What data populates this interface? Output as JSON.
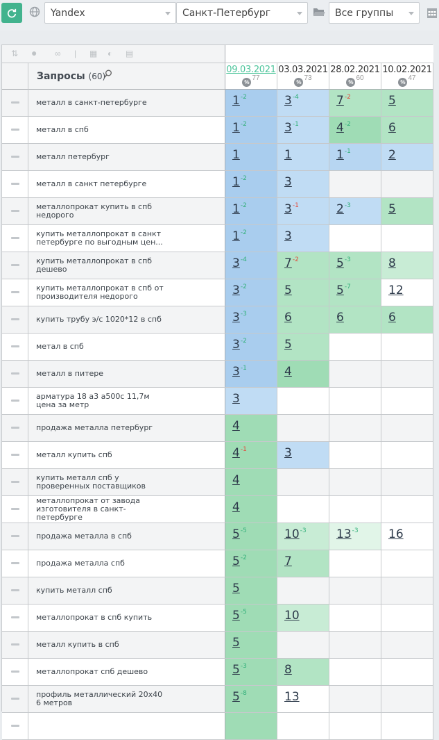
{
  "toolbar": {
    "engine": "Yandex",
    "region": "Санкт-Петербург",
    "group": "Все группы"
  },
  "header": {
    "title": "Запросы",
    "count": "(60)"
  },
  "dates": [
    {
      "date": "09.03.2021",
      "pct": "77",
      "active": true
    },
    {
      "date": "03.03.2021",
      "pct": "73",
      "active": false
    },
    {
      "date": "28.02.2021",
      "pct": "60",
      "active": false
    },
    {
      "date": "10.02.2021",
      "pct": "47",
      "active": false
    }
  ],
  "colors": {
    "accent": "#42b38e",
    "blue_cell": "#a9cdee",
    "green_cell": "#9fdcb5",
    "change_up": "#33b07a",
    "change_down": "#e24a3b"
  },
  "rows": [
    {
      "query": "металл в санкт-петербурге",
      "cells": [
        {
          "pos": "1",
          "ch": "-2",
          "dir": "g",
          "bg": "bl-d"
        },
        {
          "pos": "3",
          "ch": "-4",
          "dir": "g",
          "bg": "bl-l"
        },
        {
          "pos": "7",
          "ch": "-2",
          "dir": "r",
          "bg": "gr-m"
        },
        {
          "pos": "5",
          "ch": "",
          "dir": "",
          "bg": "gr-m"
        }
      ]
    },
    {
      "query": "металл в спб",
      "cells": [
        {
          "pos": "1",
          "ch": "-2",
          "dir": "g",
          "bg": "bl-d"
        },
        {
          "pos": "3",
          "ch": "-1",
          "dir": "g",
          "bg": "bl-l"
        },
        {
          "pos": "4",
          "ch": "-2",
          "dir": "g",
          "bg": "gr-d"
        },
        {
          "pos": "6",
          "ch": "",
          "dir": "",
          "bg": "gr-m"
        }
      ]
    },
    {
      "query": "металл петербург",
      "cells": [
        {
          "pos": "1",
          "ch": "",
          "dir": "",
          "bg": "bl-d"
        },
        {
          "pos": "1",
          "ch": "",
          "dir": "",
          "bg": "bl-l"
        },
        {
          "pos": "1",
          "ch": "-1",
          "dir": "g",
          "bg": "bl-m"
        },
        {
          "pos": "2",
          "ch": "",
          "dir": "",
          "bg": "bl-l"
        }
      ]
    },
    {
      "query": "металл в санкт петербурге",
      "cells": [
        {
          "pos": "1",
          "ch": "-2",
          "dir": "g",
          "bg": "bl-d"
        },
        {
          "pos": "3",
          "ch": "",
          "dir": "",
          "bg": "bl-l"
        },
        {
          "pos": "",
          "ch": "",
          "dir": "",
          "bg": "gy"
        },
        {
          "pos": "",
          "ch": "",
          "dir": "",
          "bg": "gy"
        }
      ]
    },
    {
      "query": "металлопрокат купить в спб недорого",
      "cells": [
        {
          "pos": "1",
          "ch": "-2",
          "dir": "g",
          "bg": "bl-d"
        },
        {
          "pos": "3",
          "ch": "-1",
          "dir": "r",
          "bg": "bl-l"
        },
        {
          "pos": "2",
          "ch": "-3",
          "dir": "g",
          "bg": "bl-l"
        },
        {
          "pos": "5",
          "ch": "",
          "dir": "",
          "bg": "gr-m"
        }
      ]
    },
    {
      "query": "купить металлопрокат в санкт петербурге по выгодным цен...",
      "cells": [
        {
          "pos": "1",
          "ch": "-2",
          "dir": "g",
          "bg": "bl-d"
        },
        {
          "pos": "3",
          "ch": "",
          "dir": "",
          "bg": "bl-l"
        },
        {
          "pos": "",
          "ch": "",
          "dir": "",
          "bg": "wh"
        },
        {
          "pos": "",
          "ch": "",
          "dir": "",
          "bg": "wh"
        }
      ]
    },
    {
      "query": "купить металлопрокат в спб дешево",
      "cells": [
        {
          "pos": "3",
          "ch": "-4",
          "dir": "g",
          "bg": "bl-d"
        },
        {
          "pos": "7",
          "ch": "-2",
          "dir": "r",
          "bg": "gr-m"
        },
        {
          "pos": "5",
          "ch": "-3",
          "dir": "g",
          "bg": "gr-m"
        },
        {
          "pos": "8",
          "ch": "",
          "dir": "",
          "bg": "gr-l"
        }
      ]
    },
    {
      "query": "купить металлопрокат в спб от производителя недорого",
      "cells": [
        {
          "pos": "3",
          "ch": "-2",
          "dir": "g",
          "bg": "bl-d"
        },
        {
          "pos": "5",
          "ch": "",
          "dir": "",
          "bg": "gr-m"
        },
        {
          "pos": "5",
          "ch": "-7",
          "dir": "g",
          "bg": "gr-m"
        },
        {
          "pos": "12",
          "ch": "",
          "dir": "",
          "bg": "wh"
        }
      ]
    },
    {
      "query": "купить трубу э/с 1020*12 в спб",
      "cells": [
        {
          "pos": "3",
          "ch": "-3",
          "dir": "g",
          "bg": "bl-d"
        },
        {
          "pos": "6",
          "ch": "",
          "dir": "",
          "bg": "gr-m"
        },
        {
          "pos": "6",
          "ch": "",
          "dir": "",
          "bg": "gr-m"
        },
        {
          "pos": "6",
          "ch": "",
          "dir": "",
          "bg": "gr-m"
        }
      ]
    },
    {
      "query": "метал в спб",
      "cells": [
        {
          "pos": "3",
          "ch": "-2",
          "dir": "g",
          "bg": "bl-d"
        },
        {
          "pos": "5",
          "ch": "",
          "dir": "",
          "bg": "gr-m"
        },
        {
          "pos": "",
          "ch": "",
          "dir": "",
          "bg": "wh"
        },
        {
          "pos": "",
          "ch": "",
          "dir": "",
          "bg": "wh"
        }
      ]
    },
    {
      "query": "металл в питере",
      "cells": [
        {
          "pos": "3",
          "ch": "-1",
          "dir": "g",
          "bg": "bl-d"
        },
        {
          "pos": "4",
          "ch": "",
          "dir": "",
          "bg": "gr-d"
        },
        {
          "pos": "",
          "ch": "",
          "dir": "",
          "bg": "gy"
        },
        {
          "pos": "",
          "ch": "",
          "dir": "",
          "bg": "gy"
        }
      ]
    },
    {
      "query": "арматура 18 а3 а500с 11,7м цена за метр",
      "cells": [
        {
          "pos": "3",
          "ch": "",
          "dir": "",
          "bg": "bl-l"
        },
        {
          "pos": "",
          "ch": "",
          "dir": "",
          "bg": "wh"
        },
        {
          "pos": "",
          "ch": "",
          "dir": "",
          "bg": "wh"
        },
        {
          "pos": "",
          "ch": "",
          "dir": "",
          "bg": "wh"
        }
      ]
    },
    {
      "query": "продажа металла петербург",
      "cells": [
        {
          "pos": "4",
          "ch": "",
          "dir": "",
          "bg": "gr-d"
        },
        {
          "pos": "",
          "ch": "",
          "dir": "",
          "bg": "gy"
        },
        {
          "pos": "",
          "ch": "",
          "dir": "",
          "bg": "gy"
        },
        {
          "pos": "",
          "ch": "",
          "dir": "",
          "bg": "gy"
        }
      ]
    },
    {
      "query": "металл купить спб",
      "cells": [
        {
          "pos": "4",
          "ch": "-1",
          "dir": "r",
          "bg": "gr-d"
        },
        {
          "pos": "3",
          "ch": "",
          "dir": "",
          "bg": "bl-l"
        },
        {
          "pos": "",
          "ch": "",
          "dir": "",
          "bg": "wh"
        },
        {
          "pos": "",
          "ch": "",
          "dir": "",
          "bg": "wh"
        }
      ]
    },
    {
      "query": "купить металл спб у проверенных поставщиков",
      "cells": [
        {
          "pos": "4",
          "ch": "",
          "dir": "",
          "bg": "gr-d"
        },
        {
          "pos": "",
          "ch": "",
          "dir": "",
          "bg": "gy"
        },
        {
          "pos": "",
          "ch": "",
          "dir": "",
          "bg": "gy"
        },
        {
          "pos": "",
          "ch": "",
          "dir": "",
          "bg": "gy"
        }
      ]
    },
    {
      "query": "металлопрокат от завода изготовителя в санкт-петербурге",
      "cells": [
        {
          "pos": "4",
          "ch": "",
          "dir": "",
          "bg": "gr-d"
        },
        {
          "pos": "",
          "ch": "",
          "dir": "",
          "bg": "wh"
        },
        {
          "pos": "",
          "ch": "",
          "dir": "",
          "bg": "wh"
        },
        {
          "pos": "",
          "ch": "",
          "dir": "",
          "bg": "wh"
        }
      ]
    },
    {
      "query": "продажа металла в спб",
      "cells": [
        {
          "pos": "5",
          "ch": "-5",
          "dir": "g",
          "bg": "gr-d"
        },
        {
          "pos": "10",
          "ch": "-3",
          "dir": "g",
          "bg": "gr-l"
        },
        {
          "pos": "13",
          "ch": "-3",
          "dir": "g",
          "bg": "gr-xl"
        },
        {
          "pos": "16",
          "ch": "",
          "dir": "",
          "bg": "wh"
        }
      ]
    },
    {
      "query": "продажа металла спб",
      "cells": [
        {
          "pos": "5",
          "ch": "-2",
          "dir": "g",
          "bg": "gr-d"
        },
        {
          "pos": "7",
          "ch": "",
          "dir": "",
          "bg": "gr-m"
        },
        {
          "pos": "",
          "ch": "",
          "dir": "",
          "bg": "wh"
        },
        {
          "pos": "",
          "ch": "",
          "dir": "",
          "bg": "wh"
        }
      ]
    },
    {
      "query": "купить металл спб",
      "cells": [
        {
          "pos": "5",
          "ch": "",
          "dir": "",
          "bg": "gr-d"
        },
        {
          "pos": "",
          "ch": "",
          "dir": "",
          "bg": "gy"
        },
        {
          "pos": "",
          "ch": "",
          "dir": "",
          "bg": "gy"
        },
        {
          "pos": "",
          "ch": "",
          "dir": "",
          "bg": "gy"
        }
      ]
    },
    {
      "query": "металлопрокат в спб купить",
      "cells": [
        {
          "pos": "5",
          "ch": "-5",
          "dir": "g",
          "bg": "gr-d"
        },
        {
          "pos": "10",
          "ch": "",
          "dir": "",
          "bg": "gr-l"
        },
        {
          "pos": "",
          "ch": "",
          "dir": "",
          "bg": "wh"
        },
        {
          "pos": "",
          "ch": "",
          "dir": "",
          "bg": "wh"
        }
      ]
    },
    {
      "query": "металл купить в спб",
      "cells": [
        {
          "pos": "5",
          "ch": "",
          "dir": "",
          "bg": "gr-d"
        },
        {
          "pos": "",
          "ch": "",
          "dir": "",
          "bg": "gy"
        },
        {
          "pos": "",
          "ch": "",
          "dir": "",
          "bg": "gy"
        },
        {
          "pos": "",
          "ch": "",
          "dir": "",
          "bg": "gy"
        }
      ]
    },
    {
      "query": "металлопрокат спб дешево",
      "cells": [
        {
          "pos": "5",
          "ch": "-3",
          "dir": "g",
          "bg": "gr-d"
        },
        {
          "pos": "8",
          "ch": "",
          "dir": "",
          "bg": "gr-m"
        },
        {
          "pos": "",
          "ch": "",
          "dir": "",
          "bg": "wh"
        },
        {
          "pos": "",
          "ch": "",
          "dir": "",
          "bg": "wh"
        }
      ]
    },
    {
      "query": "профиль металлический 20х40 6 метров",
      "cells": [
        {
          "pos": "5",
          "ch": "-8",
          "dir": "g",
          "bg": "gr-d"
        },
        {
          "pos": "13",
          "ch": "",
          "dir": "",
          "bg": "wh"
        },
        {
          "pos": "",
          "ch": "",
          "dir": "",
          "bg": "gy"
        },
        {
          "pos": "",
          "ch": "",
          "dir": "",
          "bg": "gy"
        }
      ]
    },
    {
      "query": "",
      "cells": [
        {
          "pos": "",
          "ch": "",
          "dir": "",
          "bg": "gr-d"
        },
        {
          "pos": "",
          "ch": "",
          "dir": "",
          "bg": "wh"
        },
        {
          "pos": "",
          "ch": "",
          "dir": "",
          "bg": "wh"
        },
        {
          "pos": "",
          "ch": "",
          "dir": "",
          "bg": "wh"
        }
      ]
    }
  ]
}
